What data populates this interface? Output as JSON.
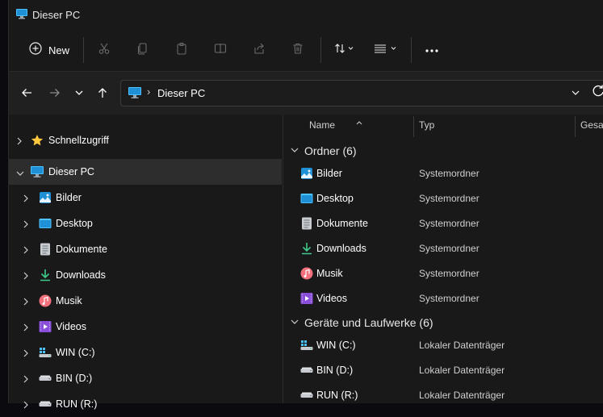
{
  "window": {
    "title": "Dieser PC"
  },
  "toolbar": {
    "new_label": "New"
  },
  "address": {
    "path": "Dieser PC"
  },
  "sidebar": {
    "items": [
      {
        "label": "Schnellzugriff",
        "icon": "star-icon"
      },
      {
        "label": "Dieser PC",
        "icon": "monitor-icon",
        "selected": true
      },
      {
        "label": "Bilder",
        "icon": "pictures-icon"
      },
      {
        "label": "Desktop",
        "icon": "desktop-icon"
      },
      {
        "label": "Dokumente",
        "icon": "documents-icon"
      },
      {
        "label": "Downloads",
        "icon": "download-icon"
      },
      {
        "label": "Musik",
        "icon": "music-icon"
      },
      {
        "label": "Videos",
        "icon": "videos-icon"
      },
      {
        "label": "WIN (C:)",
        "icon": "windows-drive-icon"
      },
      {
        "label": "BIN (D:)",
        "icon": "drive-icon"
      },
      {
        "label": "RUN (R:)",
        "icon": "drive-icon"
      }
    ]
  },
  "columns": {
    "name": "Name",
    "type": "Typ",
    "total": "Gesan"
  },
  "groups": [
    {
      "label": "Ordner (6)",
      "items": [
        {
          "name": "Bilder",
          "type": "Systemordner",
          "icon": "pictures-icon"
        },
        {
          "name": "Desktop",
          "type": "Systemordner",
          "icon": "desktop-icon"
        },
        {
          "name": "Dokumente",
          "type": "Systemordner",
          "icon": "documents-icon"
        },
        {
          "name": "Downloads",
          "type": "Systemordner",
          "icon": "download-icon"
        },
        {
          "name": "Musik",
          "type": "Systemordner",
          "icon": "music-icon"
        },
        {
          "name": "Videos",
          "type": "Systemordner",
          "icon": "videos-icon"
        }
      ]
    },
    {
      "label": "Geräte und Laufwerke (6)",
      "items": [
        {
          "name": "WIN (C:)",
          "type": "Lokaler Datenträger",
          "icon": "windows-drive-icon"
        },
        {
          "name": "BIN (D:)",
          "type": "Lokaler Datenträger",
          "icon": "drive-icon"
        },
        {
          "name": "RUN (R:)",
          "type": "Lokaler Datenträger",
          "icon": "drive-icon"
        }
      ]
    }
  ],
  "colors": {
    "accent": "#4cc2ff",
    "background": "#191919",
    "selected": "#2d2d2d"
  }
}
